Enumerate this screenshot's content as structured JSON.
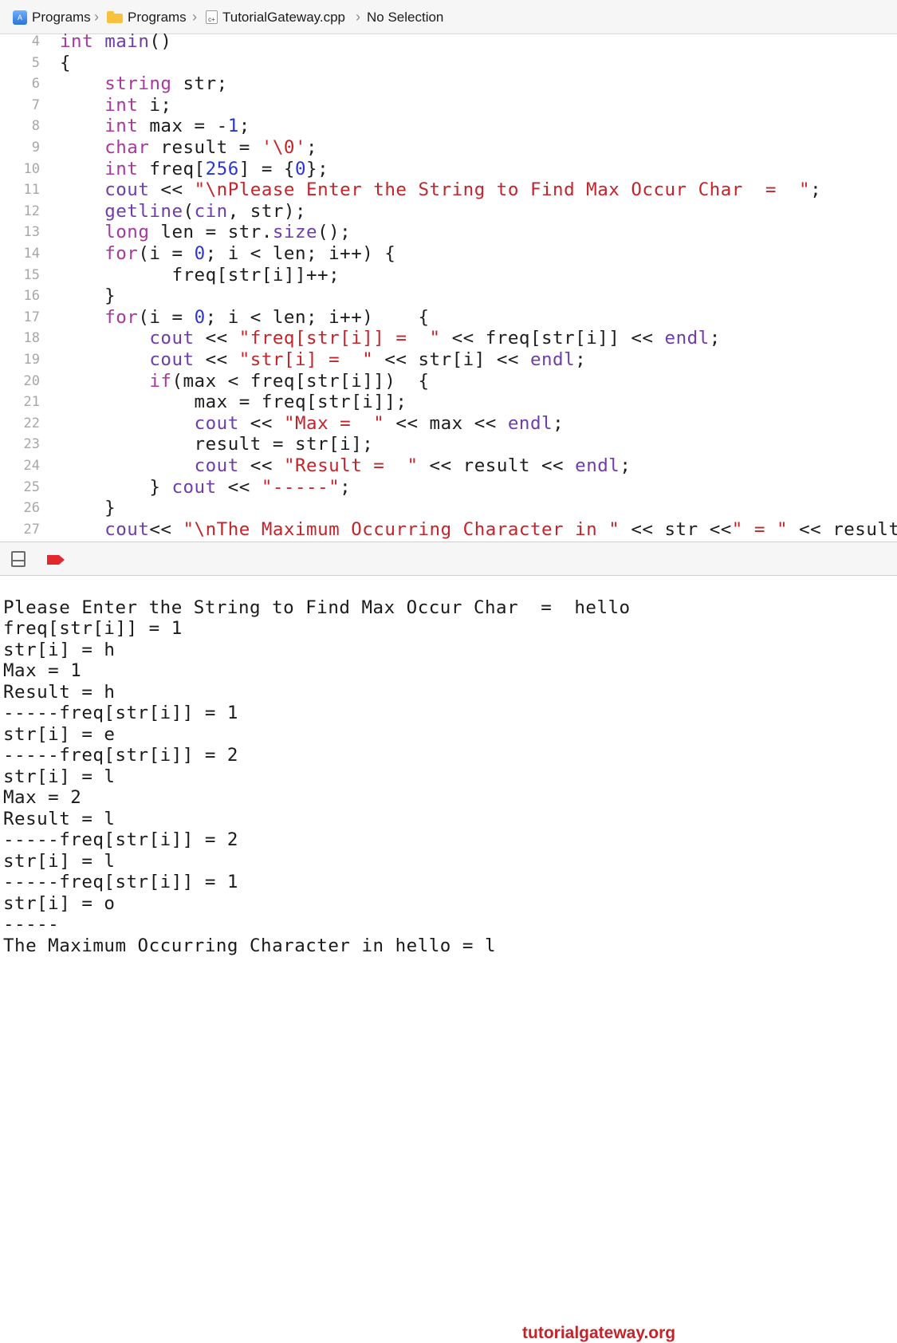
{
  "breadcrumb": {
    "items": [
      {
        "label": "Programs",
        "icon": "xcode-project-icon"
      },
      {
        "label": "Programs",
        "icon": "folder-icon"
      },
      {
        "label": "TutorialGateway.cpp",
        "icon": "cpp-file-icon"
      },
      {
        "label": "No Selection",
        "icon": ""
      }
    ]
  },
  "editor": {
    "lines": [
      {
        "n": "4",
        "tokens": [
          [
            "k",
            "int"
          ],
          [
            "t",
            " "
          ],
          [
            "f",
            "main"
          ],
          [
            "t",
            "()"
          ]
        ]
      },
      {
        "n": "5",
        "tokens": [
          [
            "t",
            "{"
          ]
        ]
      },
      {
        "n": "6",
        "tokens": [
          [
            "t",
            "    "
          ],
          [
            "k",
            "string"
          ],
          [
            "t",
            " str;"
          ]
        ]
      },
      {
        "n": "7",
        "tokens": [
          [
            "t",
            "    "
          ],
          [
            "k",
            "int"
          ],
          [
            "t",
            " i;"
          ]
        ]
      },
      {
        "n": "8",
        "tokens": [
          [
            "t",
            "    "
          ],
          [
            "k",
            "int"
          ],
          [
            "t",
            " max = -"
          ],
          [
            "n",
            "1"
          ],
          [
            "t",
            ";"
          ]
        ]
      },
      {
        "n": "9",
        "tokens": [
          [
            "t",
            "    "
          ],
          [
            "k",
            "char"
          ],
          [
            "t",
            " result = "
          ],
          [
            "s",
            "'\\0'"
          ],
          [
            "t",
            ";"
          ]
        ]
      },
      {
        "n": "10",
        "tokens": [
          [
            "t",
            "    "
          ],
          [
            "k",
            "int"
          ],
          [
            "t",
            " freq["
          ],
          [
            "n",
            "256"
          ],
          [
            "t",
            "] = {"
          ],
          [
            "n",
            "0"
          ],
          [
            "t",
            "};"
          ]
        ]
      },
      {
        "n": "11",
        "tokens": [
          [
            "t",
            "    "
          ],
          [
            "f",
            "cout"
          ],
          [
            "t",
            " << "
          ],
          [
            "s",
            "\"\\nPlease Enter the String to Find Max Occur Char  =  \""
          ],
          [
            "t",
            ";"
          ]
        ]
      },
      {
        "n": "12",
        "tokens": [
          [
            "t",
            "    "
          ],
          [
            "f",
            "getline"
          ],
          [
            "t",
            "("
          ],
          [
            "f",
            "cin"
          ],
          [
            "t",
            ", str);"
          ]
        ]
      },
      {
        "n": "13",
        "tokens": [
          [
            "t",
            "    "
          ],
          [
            "k",
            "long"
          ],
          [
            "t",
            " len = str."
          ],
          [
            "f",
            "size"
          ],
          [
            "t",
            "();"
          ]
        ]
      },
      {
        "n": "14",
        "tokens": [
          [
            "t",
            "    "
          ],
          [
            "k",
            "for"
          ],
          [
            "t",
            "(i = "
          ],
          [
            "n",
            "0"
          ],
          [
            "t",
            "; i < len; i++) {"
          ]
        ]
      },
      {
        "n": "15",
        "tokens": [
          [
            "t",
            "          freq[str[i]]++;"
          ]
        ]
      },
      {
        "n": "16",
        "tokens": [
          [
            "t",
            "    }"
          ]
        ]
      },
      {
        "n": "17",
        "tokens": [
          [
            "t",
            "    "
          ],
          [
            "k",
            "for"
          ],
          [
            "t",
            "(i = "
          ],
          [
            "n",
            "0"
          ],
          [
            "t",
            "; i < len; i++)    {"
          ]
        ]
      },
      {
        "n": "18",
        "tokens": [
          [
            "t",
            "        "
          ],
          [
            "f",
            "cout"
          ],
          [
            "t",
            " << "
          ],
          [
            "s",
            "\"freq[str[i]] =  \""
          ],
          [
            "t",
            " << freq[str[i]] << "
          ],
          [
            "f",
            "endl"
          ],
          [
            "t",
            ";"
          ]
        ]
      },
      {
        "n": "19",
        "tokens": [
          [
            "t",
            "        "
          ],
          [
            "f",
            "cout"
          ],
          [
            "t",
            " << "
          ],
          [
            "s",
            "\"str[i] =  \""
          ],
          [
            "t",
            " << str[i] << "
          ],
          [
            "f",
            "endl"
          ],
          [
            "t",
            ";"
          ]
        ]
      },
      {
        "n": "20",
        "tokens": [
          [
            "t",
            "        "
          ],
          [
            "k",
            "if"
          ],
          [
            "t",
            "(max < freq[str[i]])  {"
          ]
        ]
      },
      {
        "n": "21",
        "tokens": [
          [
            "t",
            "            max = freq[str[i]];"
          ]
        ]
      },
      {
        "n": "22",
        "tokens": [
          [
            "t",
            "            "
          ],
          [
            "f",
            "cout"
          ],
          [
            "t",
            " << "
          ],
          [
            "s",
            "\"Max =  \""
          ],
          [
            "t",
            " << max << "
          ],
          [
            "f",
            "endl"
          ],
          [
            "t",
            ";"
          ]
        ]
      },
      {
        "n": "23",
        "tokens": [
          [
            "t",
            "            result = str[i];"
          ]
        ]
      },
      {
        "n": "24",
        "tokens": [
          [
            "t",
            "            "
          ],
          [
            "f",
            "cout"
          ],
          [
            "t",
            " << "
          ],
          [
            "s",
            "\"Result =  \""
          ],
          [
            "t",
            " << result << "
          ],
          [
            "f",
            "endl"
          ],
          [
            "t",
            ";"
          ]
        ]
      },
      {
        "n": "25",
        "tokens": [
          [
            "t",
            "        } "
          ],
          [
            "f",
            "cout"
          ],
          [
            "t",
            " << "
          ],
          [
            "s",
            "\"-----\""
          ],
          [
            "t",
            ";"
          ]
        ]
      },
      {
        "n": "26",
        "tokens": [
          [
            "t",
            "    }"
          ]
        ]
      },
      {
        "n": "27",
        "tokens": [
          [
            "t",
            "    "
          ],
          [
            "f",
            "cout"
          ],
          [
            "t",
            "<< "
          ],
          [
            "s",
            "\"\\nThe Maximum Occurring Character in \""
          ],
          [
            "t",
            " << str <<"
          ],
          [
            "s",
            "\" = \""
          ],
          [
            "t",
            " << result;"
          ]
        ]
      }
    ]
  },
  "console": {
    "lines": [
      "",
      "Please Enter the String to Find Max Occur Char  =  hello",
      "freq[str[i]] = 1",
      "str[i] = h",
      "Max = 1",
      "Result = h",
      "-----freq[str[i]] = 1",
      "str[i] = e",
      "-----freq[str[i]] = 2",
      "str[i] = l",
      "Max = 2",
      "Result = l",
      "-----freq[str[i]] = 2",
      "str[i] = l",
      "-----freq[str[i]] = 1",
      "str[i] = o",
      "-----",
      "The Maximum Occurring Character in hello = l"
    ],
    "watermark": "tutorialgateway.org"
  },
  "colors": {
    "keyword": "#a8379e",
    "string": "#c4232a",
    "number": "#2b35d6",
    "function": "#6e3cad",
    "breakpoint": "#e0282e"
  }
}
